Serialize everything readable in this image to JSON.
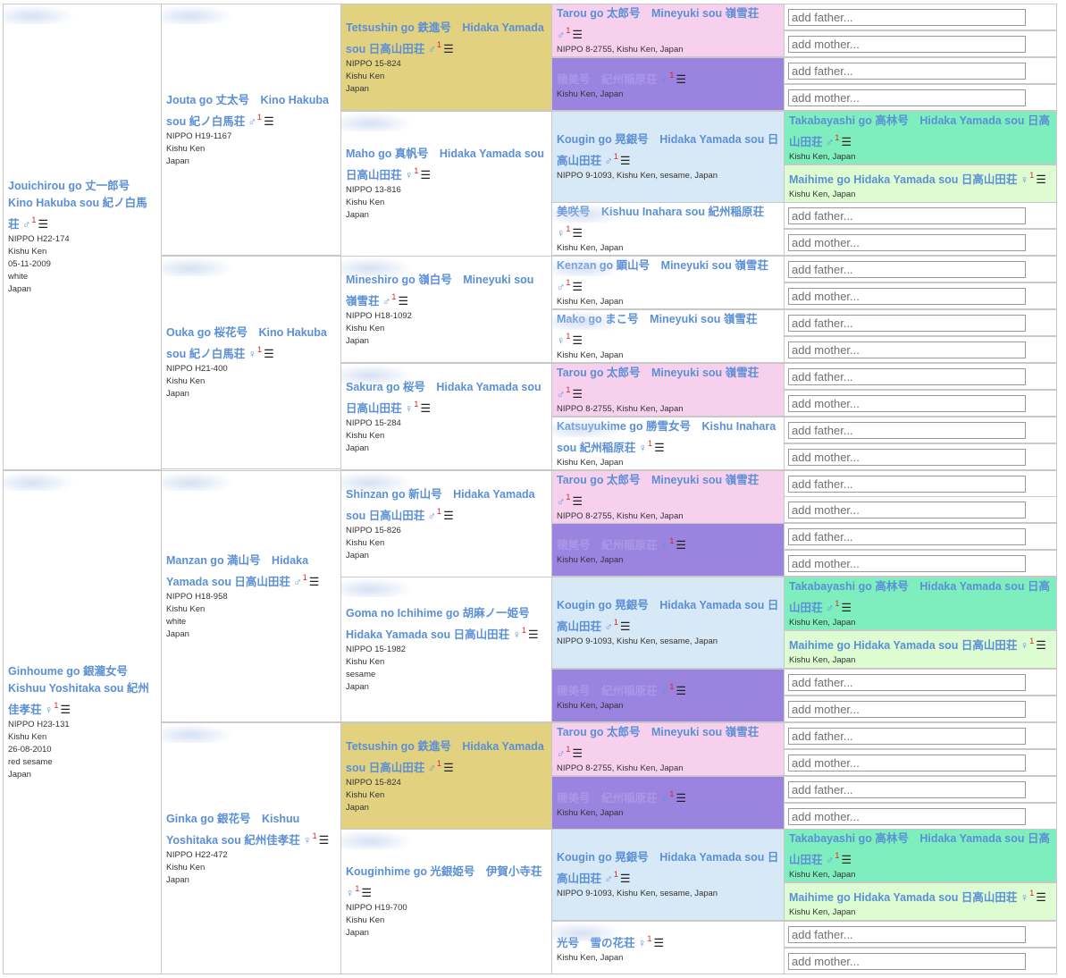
{
  "placeholders": {
    "father": "add father...",
    "mother": "add mother..."
  },
  "colors": {
    "link": "#5b8fd6",
    "superscript": "#e02020",
    "pink": "#f7d0ee",
    "purple": "#9b83e0",
    "light_blue": "#d7e9f6",
    "mint": "#7feebf",
    "light_green": "#ddfcd2",
    "gold": "#e2d27f",
    "border": "#c8c8c8"
  },
  "gen1": [
    {
      "name": "Jouichirou go 丈一郎号　Kino Hakuba sou 紀ノ白馬荘",
      "sex": "♂",
      "sup": "1",
      "lines": [
        "NIPPO H22-174",
        "Kishu Ken",
        "05-11-2009",
        "white",
        "Japan"
      ]
    },
    {
      "name": "Ginhoume go 銀瀧女号　Kishuu Yoshitaka sou 紀州佳孝荘",
      "sex": "♀",
      "sup": "1",
      "lines": [
        "NIPPO H23-131",
        "Kishu Ken",
        "26-08-2010",
        "red sesame",
        "Japan"
      ]
    }
  ],
  "gen2": [
    {
      "name": "Jouta go 丈太号　Kino Hakuba sou 紀ノ白馬荘",
      "sex": "♂",
      "sup": "1",
      "lines": [
        "NIPPO H19-1167",
        "Kishu Ken",
        "Japan"
      ]
    },
    {
      "name": "Ouka go 桜花号　Kino Hakuba sou 紀ノ白馬荘",
      "sex": "♀",
      "sup": "1",
      "lines": [
        "NIPPO H21-400",
        "Kishu Ken",
        "Japan"
      ]
    },
    {
      "name": "Manzan go 満山号　Hidaka Yamada sou 日高山田荘",
      "sex": "♂",
      "sup": "1",
      "lines": [
        "NIPPO H18-958",
        "Kishu Ken",
        "white",
        "Japan"
      ]
    },
    {
      "name": "Ginka go 銀花号　Kishuu Yoshitaka sou 紀州佳孝荘",
      "sex": "♀",
      "sup": "1",
      "lines": [
        "NIPPO H22-472",
        "Kishu Ken",
        "Japan"
      ]
    }
  ],
  "gen3": [
    {
      "name": "Tetsushin go 鉄進号　Hidaka Yamada sou 日高山田荘",
      "sex": "♂",
      "sup": "1",
      "lines": [
        "NIPPO 15-824",
        "Kishu Ken",
        "Japan"
      ],
      "color": "gold"
    },
    {
      "name": "Maho go 真帆号　Hidaka Yamada sou 日高山田荘",
      "sex": "♀",
      "sup": "1",
      "lines": [
        "NIPPO 13-816",
        "Kishu Ken",
        "Japan"
      ],
      "color": "white"
    },
    {
      "name": "Mineshiro go 嶺白号　Mineyuki sou 嶺雪荘",
      "sex": "♂",
      "sup": "1",
      "lines": [
        "NIPPO H18-1092",
        "Kishu Ken",
        "Japan"
      ],
      "color": "white"
    },
    {
      "name": "Sakura go 桜号　Hidaka Yamada sou 日高山田荘",
      "sex": "♀",
      "sup": "1",
      "lines": [
        "NIPPO 15-284",
        "Kishu Ken",
        "Japan"
      ],
      "color": "white"
    },
    {
      "name": "Shinzan go 新山号　Hidaka Yamada sou 日高山田荘",
      "sex": "♂",
      "sup": "1",
      "lines": [
        "NIPPO 15-826",
        "Kishu Ken",
        "Japan"
      ],
      "color": "white"
    },
    {
      "name": "Goma no Ichihime go 胡麻ノ一姫号　Hidaka Yamada sou 日高山田荘",
      "sex": "♀",
      "sup": "1",
      "lines": [
        "NIPPO 15-1982",
        "Kishu Ken",
        "sesame",
        "Japan"
      ],
      "color": "white"
    },
    {
      "name": "Tetsushin go 鉄進号　Hidaka Yamada sou 日高山田荘",
      "sex": "♂",
      "sup": "1",
      "lines": [
        "NIPPO 15-824",
        "Kishu Ken",
        "Japan"
      ],
      "color": "gold"
    },
    {
      "name": "Kouginhime go 光銀姫号　伊賀小寺荘",
      "sex": "♀",
      "sup": "1",
      "lines": [
        "NIPPO H19-700",
        "Kishu Ken",
        "Japan"
      ],
      "color": "white"
    }
  ],
  "gen4": [
    {
      "name": "Tarou go 太郎号　Mineyuki sou 嶺雪荘",
      "sex": "♂",
      "sup": "1",
      "lines": [
        "NIPPO 8-2755, Kishu Ken, Japan"
      ],
      "color": "pink"
    },
    {
      "name": "穂美号　紀州稲原荘",
      "sex": "♀",
      "sup": "1",
      "lines": [
        "Kishu Ken, Japan"
      ],
      "color": "purple"
    },
    {
      "name": "Kougin go 晃銀号　Hidaka Yamada sou 日高山田荘",
      "sex": "♂",
      "sup": "1",
      "lines": [
        "NIPPO 9-1093, Kishu Ken, sesame, Japan"
      ],
      "color": "blue"
    },
    {
      "name": "美咲号　Kishuu Inahara sou 紀州稲原荘",
      "sex": "♀",
      "sup": "1",
      "lines": [
        "Kishu Ken, Japan"
      ],
      "color": "white"
    },
    {
      "name": "Kenzan go 顕山号　Mineyuki sou 嶺雪荘",
      "sex": "♂",
      "sup": "1",
      "lines": [
        "Kishu Ken, Japan"
      ],
      "color": "white"
    },
    {
      "name": "Mako go まこ号　Mineyuki sou 嶺雪荘",
      "sex": "♀",
      "sup": "1",
      "lines": [
        "Kishu Ken, Japan"
      ],
      "color": "white"
    },
    {
      "name": "Tarou go 太郎号　Mineyuki sou 嶺雪荘",
      "sex": "♂",
      "sup": "1",
      "lines": [
        "NIPPO 8-2755, Kishu Ken, Japan"
      ],
      "color": "pink"
    },
    {
      "name": "Katsuyukime go 勝雪女号　Kishu Inahara sou 紀州稲原荘",
      "sex": "♀",
      "sup": "1",
      "lines": [
        "Kishu Ken, Japan"
      ],
      "color": "white"
    },
    {
      "name": "Tarou go 太郎号　Mineyuki sou 嶺雪荘",
      "sex": "♂",
      "sup": "1",
      "lines": [
        "NIPPO 8-2755, Kishu Ken, Japan"
      ],
      "color": "pink"
    },
    {
      "name": "穂美号　紀州稲原荘",
      "sex": "♀",
      "sup": "1",
      "lines": [
        "Kishu Ken, Japan"
      ],
      "color": "purple"
    },
    {
      "name": "Kougin go 晃銀号　Hidaka Yamada sou 日高山田荘",
      "sex": "♂",
      "sup": "1",
      "lines": [
        "NIPPO 9-1093, Kishu Ken, sesame, Japan"
      ],
      "color": "blue"
    },
    {
      "name": "穂美号　紀州稲原荘",
      "sex": "♀",
      "sup": "1",
      "lines": [
        "Kishu Ken, Japan"
      ],
      "color": "purple"
    },
    {
      "name": "Tarou go 太郎号　Mineyuki sou 嶺雪荘",
      "sex": "♂",
      "sup": "1",
      "lines": [
        "NIPPO 8-2755, Kishu Ken, Japan"
      ],
      "color": "pink"
    },
    {
      "name": "穂美号　紀州稲原荘",
      "sex": "♀",
      "sup": "1",
      "lines": [
        "Kishu Ken, Japan"
      ],
      "color": "purple"
    },
    {
      "name": "Kougin go 晃銀号　Hidaka Yamada sou 日高山田荘",
      "sex": "♂",
      "sup": "1",
      "lines": [
        "NIPPO 9-1093, Kishu Ken, sesame, Japan"
      ],
      "color": "blue"
    },
    {
      "name": "光号　雪の花荘",
      "sex": "♀",
      "sup": "1",
      "lines": [
        "Kishu Ken, Japan"
      ],
      "color": "white"
    }
  ],
  "gen5": [
    {
      "type": "add"
    },
    {
      "type": "add"
    },
    {
      "type": "add"
    },
    {
      "type": "add"
    },
    {
      "type": "dog",
      "name": "Takabayashi go 高林号　Hidaka Yamada sou 日高山田荘",
      "sex": "♂",
      "sup": "1",
      "lines": [
        "Kishu Ken, Japan"
      ],
      "color": "mint"
    },
    {
      "type": "dog",
      "name": "Maihime go Hidaka Yamada sou 日高山田荘",
      "sex": "♀",
      "sup": "1",
      "lines": [
        "Kishu Ken, Japan"
      ],
      "color": "lightgreen"
    },
    {
      "type": "add"
    },
    {
      "type": "add"
    },
    {
      "type": "add"
    },
    {
      "type": "add"
    },
    {
      "type": "add"
    },
    {
      "type": "add"
    },
    {
      "type": "add"
    },
    {
      "type": "add"
    },
    {
      "type": "add"
    },
    {
      "type": "add"
    },
    {
      "type": "add"
    },
    {
      "type": "add"
    },
    {
      "type": "add"
    },
    {
      "type": "add"
    },
    {
      "type": "dog",
      "name": "Takabayashi go 高林号　Hidaka Yamada sou 日高山田荘",
      "sex": "♂",
      "sup": "1",
      "lines": [
        "Kishu Ken, Japan"
      ],
      "color": "mint"
    },
    {
      "type": "dog",
      "name": "Maihime go Hidaka Yamada sou 日高山田荘",
      "sex": "♀",
      "sup": "1",
      "lines": [
        "Kishu Ken, Japan"
      ],
      "color": "lightgreen"
    },
    {
      "type": "add"
    },
    {
      "type": "add"
    },
    {
      "type": "add"
    },
    {
      "type": "add"
    },
    {
      "type": "add"
    },
    {
      "type": "add"
    },
    {
      "type": "dog",
      "name": "Takabayashi go 高林号　Hidaka Yamada sou 日高山田荘",
      "sex": "♂",
      "sup": "1",
      "lines": [
        "Kishu Ken, Japan"
      ],
      "color": "mint"
    },
    {
      "type": "dog",
      "name": "Maihime go Hidaka Yamada sou 日高山田荘",
      "sex": "♀",
      "sup": "1",
      "lines": [
        "Kishu Ken, Japan"
      ],
      "color": "lightgreen"
    },
    {
      "type": "add"
    },
    {
      "type": "add"
    }
  ]
}
